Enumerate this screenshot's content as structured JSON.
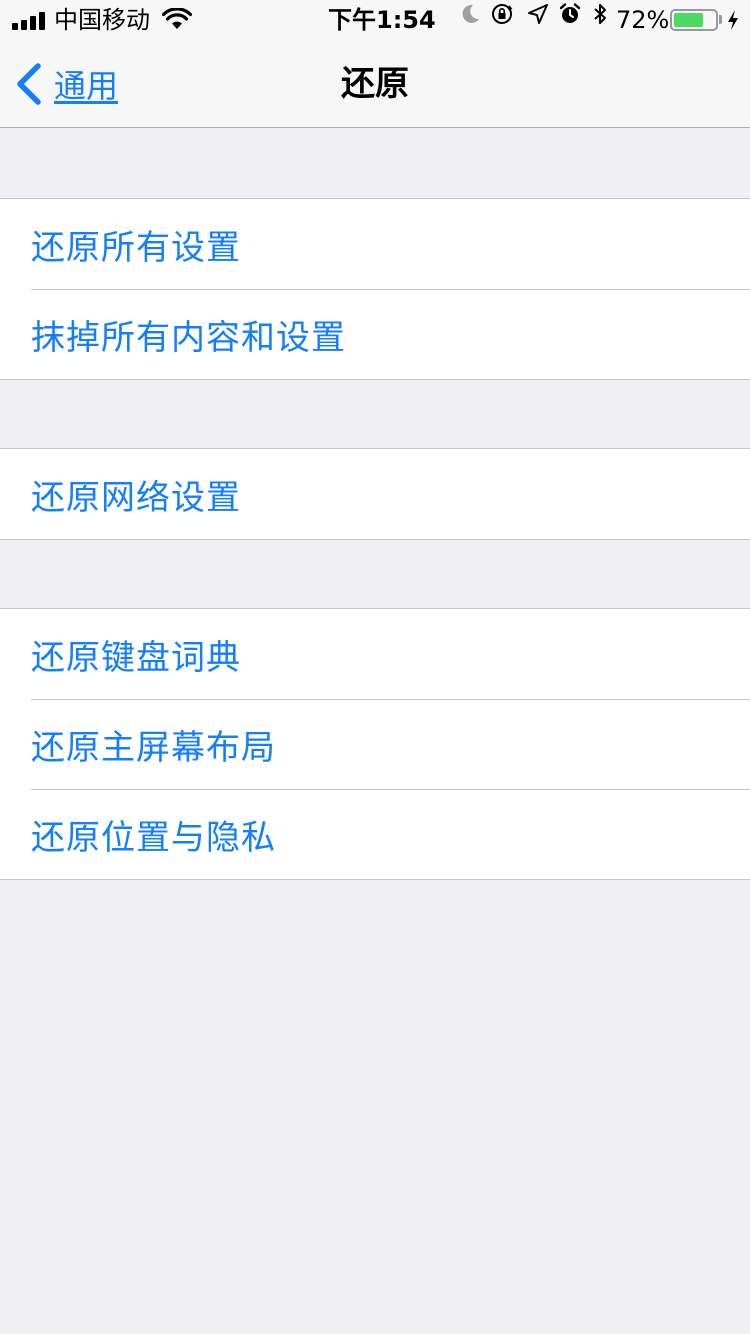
{
  "status_bar": {
    "carrier": "中国移动",
    "time": "下午1:54",
    "battery_percent": "72%",
    "battery_level": 0.72,
    "icons": [
      "signal-icon",
      "wifi-icon",
      "moon-icon",
      "orientation-lock-icon",
      "location-icon",
      "alarm-icon",
      "bluetooth-icon",
      "battery-icon",
      "charging-icon"
    ]
  },
  "nav": {
    "back_label": "通用",
    "title": "还原"
  },
  "groups": [
    {
      "items": [
        {
          "label": "还原所有设置"
        },
        {
          "label": "抹掉所有内容和设置"
        }
      ]
    },
    {
      "items": [
        {
          "label": "还原网络设置"
        }
      ]
    },
    {
      "items": [
        {
          "label": "还原键盘词典"
        },
        {
          "label": "还原主屏幕布局"
        },
        {
          "label": "还原位置与隐私"
        }
      ]
    }
  ],
  "colors": {
    "accent": "#157efb",
    "background": "#efeff4",
    "battery": "#4cd964"
  }
}
